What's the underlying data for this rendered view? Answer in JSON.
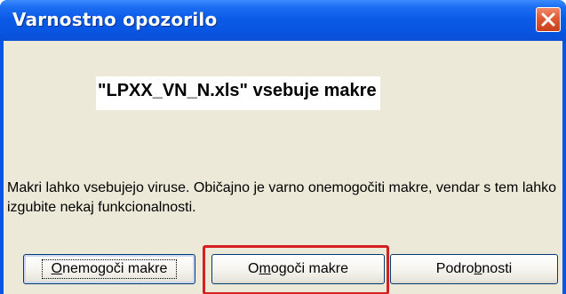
{
  "window": {
    "title": "Varnostno opozorilo",
    "close_icon": "close-x-icon"
  },
  "content": {
    "filename_message": "\"LPXX_VN_N.xls\" vsebuje makre",
    "warning_text": "Makri lahko vsebujejo viruse. Običajno je varno onemogočiti makre, vendar s tem lahko izgubite nekaj funkcionalnosti."
  },
  "buttons": {
    "disable_macros": {
      "label": "Onemogoči makre",
      "pre": "",
      "mnemonic": "O",
      "post": "nemogoči makre"
    },
    "enable_macros": {
      "label": "Omogoči makre",
      "pre": "O",
      "mnemonic": "m",
      "post": "ogoči makre"
    },
    "details": {
      "label": "Podrobnosti",
      "pre": "Podro",
      "mnemonic": "b",
      "post": "nosti"
    }
  },
  "colors": {
    "titlebar": "#0854e0",
    "client_bg": "#ece9d8",
    "highlight": "#d42020",
    "close_button": "#e05a34"
  }
}
